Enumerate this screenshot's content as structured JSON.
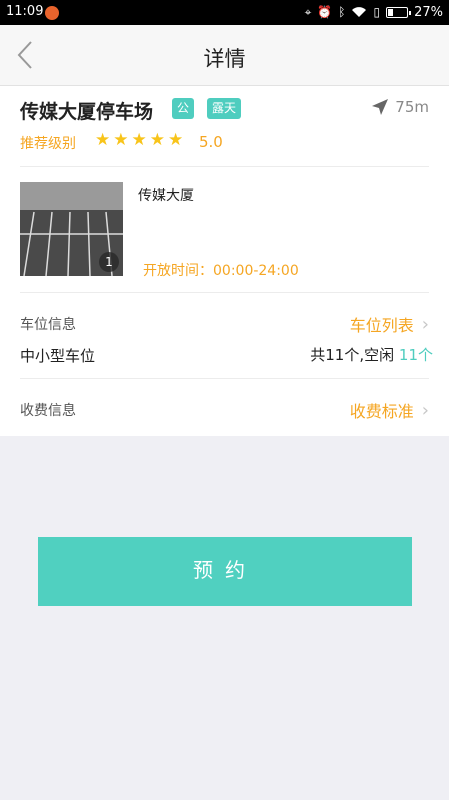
{
  "status_bar": {
    "time": "11:09",
    "battery": "27%",
    "icons": [
      "nav-arrow-icon",
      "alarm-icon",
      "bluetooth-icon",
      "wifi-icon",
      "sim-icon",
      "battery-icon"
    ]
  },
  "navbar": {
    "title": "详情",
    "back_icon": "chevron-left-icon"
  },
  "lot": {
    "name": "传媒大厦停车场",
    "tags": [
      "公",
      "露天"
    ],
    "distance": "75m",
    "rating_label": "推荐级别",
    "rating_stars": 5,
    "rating_score": "5.0",
    "photo_count": "1",
    "place_name": "传媒大厦",
    "open_hours": "开放时间：00:00-24:00"
  },
  "spaces": {
    "label": "车位信息",
    "link": "车位列表",
    "type": "中小型车位",
    "summary": "共11个,空闲",
    "free": "11个"
  },
  "fees": {
    "label": "收费信息",
    "link": "收费标准"
  },
  "actions": {
    "book": "预约"
  },
  "colors": {
    "accent": "#50d0c0",
    "orange": "#f5a623",
    "star": "#f8c41a"
  }
}
